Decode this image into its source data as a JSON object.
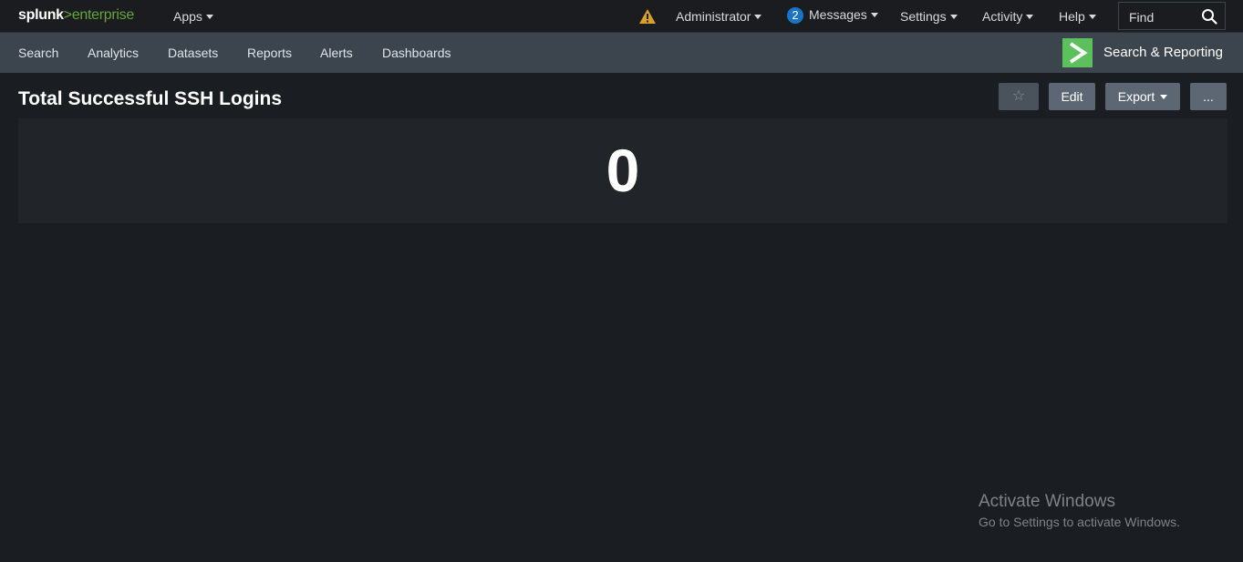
{
  "topbar": {
    "logo_main": "splunk",
    "logo_sep": ">",
    "logo_sub": "enterprise",
    "apps_label": "Apps",
    "admin_label": "Administrator",
    "messages_count": "2",
    "messages_label": "Messages",
    "settings_label": "Settings",
    "activity_label": "Activity",
    "help_label": "Help",
    "find_placeholder": "Find",
    "warning_color": "#d9a024"
  },
  "nav": {
    "items": [
      "Search",
      "Analytics",
      "Datasets",
      "Reports",
      "Alerts",
      "Dashboards"
    ],
    "app_title": "Search & Reporting",
    "app_icon_color": "#5cc05c"
  },
  "dashboard": {
    "title": "Total Successful SSH Logins",
    "star_glyph": "☆",
    "edit_label": "Edit",
    "export_label": "Export",
    "more_label": "...",
    "single_value": "0"
  },
  "watermark": {
    "title": "Activate Windows",
    "subtitle": "Go to Settings to activate Windows."
  }
}
